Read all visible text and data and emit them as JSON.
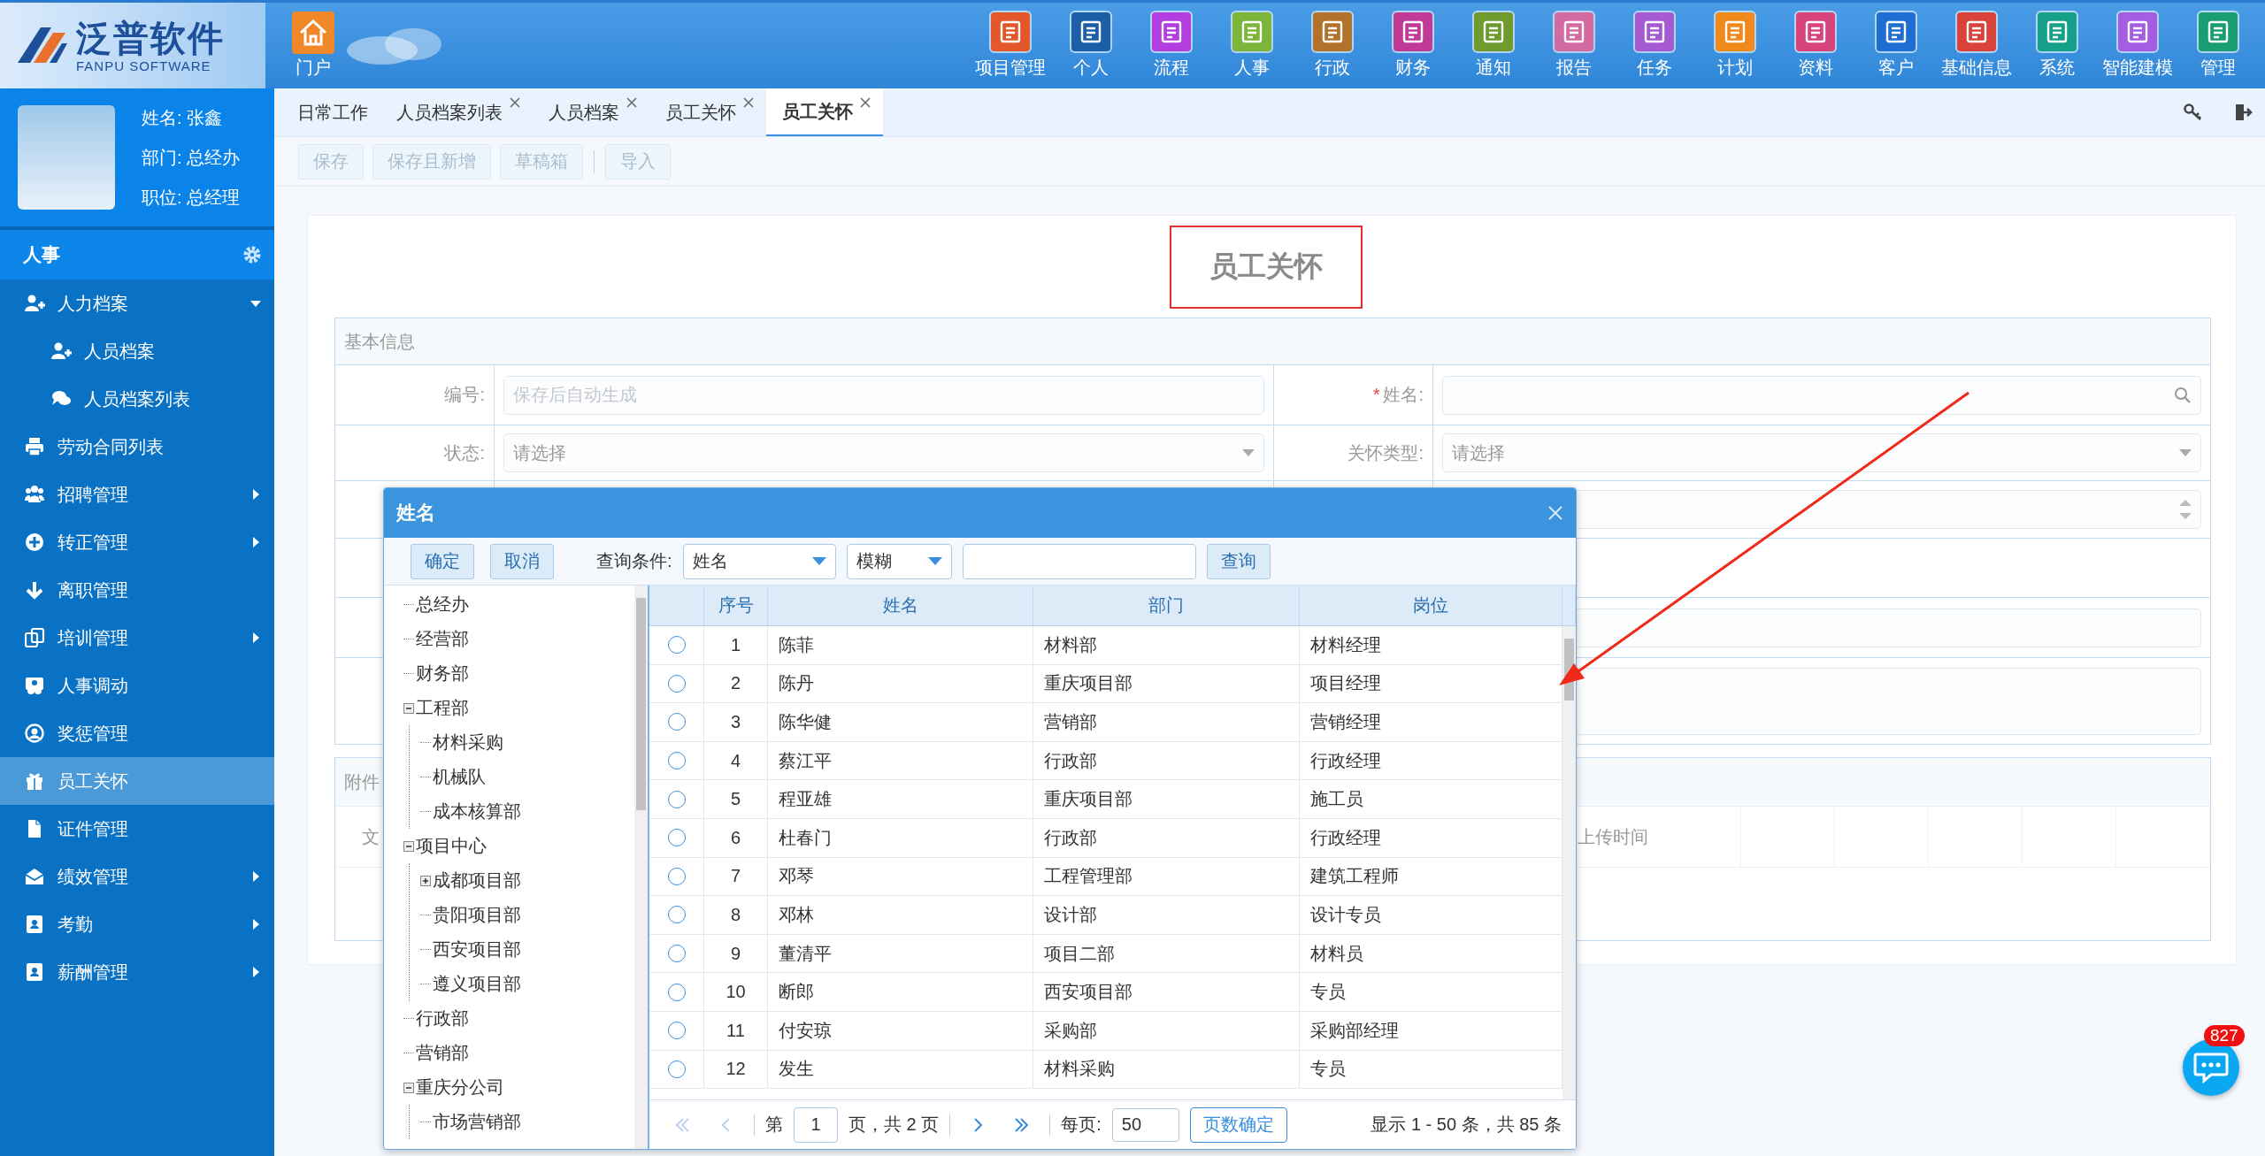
{
  "header": {
    "logo_title": "泛普软件",
    "logo_subtitle": "FANPU SOFTWARE",
    "portal": {
      "label": "门户"
    },
    "nav": [
      {
        "label": "项目管理",
        "color": "#e2582a"
      },
      {
        "label": "个人",
        "color": "#1d5fa6"
      },
      {
        "label": "流程",
        "color": "#b23de0"
      },
      {
        "label": "人事",
        "color": "#7cb53a"
      },
      {
        "label": "行政",
        "color": "#b3722c"
      },
      {
        "label": "财务",
        "color": "#c23a98"
      },
      {
        "label": "通知",
        "color": "#6e9a2e"
      },
      {
        "label": "报告",
        "color": "#d46aa2"
      },
      {
        "label": "任务",
        "color": "#a65ad2"
      },
      {
        "label": "计划",
        "color": "#f08a1c"
      },
      {
        "label": "资料",
        "color": "#d9437c"
      },
      {
        "label": "客户",
        "color": "#1f6fd2"
      },
      {
        "label": "基础信息",
        "color": "#d9433a"
      },
      {
        "label": "系统",
        "color": "#16a08a"
      },
      {
        "label": "智能建模",
        "color": "#a45ce2"
      },
      {
        "label": "管理",
        "color": "#189e72"
      }
    ]
  },
  "profile": {
    "name": "姓名: 张鑫",
    "department": "部门: 总经办",
    "position": "职位: 总经理"
  },
  "menu": {
    "title": "人事",
    "items": [
      {
        "label": "人力档案",
        "kind": "group",
        "expanded": true,
        "selected": false,
        "children": [
          {
            "label": "人员档案",
            "selected": false
          },
          {
            "label": "人员档案列表",
            "selected": false
          }
        ]
      },
      {
        "label": "劳动合同列表",
        "kind": "link",
        "selected": false
      },
      {
        "label": "招聘管理",
        "kind": "group",
        "expanded": false,
        "selected": false
      },
      {
        "label": "转正管理",
        "kind": "group",
        "expanded": false,
        "selected": false
      },
      {
        "label": "离职管理",
        "kind": "link",
        "selected": false
      },
      {
        "label": "培训管理",
        "kind": "group",
        "expanded": false,
        "selected": false
      },
      {
        "label": "人事调动",
        "kind": "link",
        "selected": false
      },
      {
        "label": "奖惩管理",
        "kind": "link",
        "selected": false
      },
      {
        "label": "员工关怀",
        "kind": "link",
        "selected": true
      },
      {
        "label": "证件管理",
        "kind": "link",
        "selected": false
      },
      {
        "label": "绩效管理",
        "kind": "group",
        "expanded": false,
        "selected": false
      },
      {
        "label": "考勤",
        "kind": "group",
        "expanded": false,
        "selected": false
      },
      {
        "label": "薪酬管理",
        "kind": "group",
        "expanded": false,
        "selected": false
      }
    ]
  },
  "tabs": [
    {
      "label": "日常工作",
      "closable": false,
      "selected": false
    },
    {
      "label": "人员档案列表",
      "closable": true,
      "selected": false
    },
    {
      "label": "人员档案",
      "closable": true,
      "selected": false
    },
    {
      "label": "员工关怀",
      "closable": true,
      "selected": false
    },
    {
      "label": "员工关怀",
      "closable": true,
      "selected": true
    }
  ],
  "toolbar": {
    "buttons": [
      {
        "label": "保存",
        "disabled": true
      },
      {
        "label": "保存且新增",
        "disabled": true
      },
      {
        "label": "草稿箱",
        "disabled": true
      },
      {
        "label": "导入",
        "disabled": true
      }
    ]
  },
  "form": {
    "title": "员工关怀",
    "section": "基本信息",
    "rows": [
      {
        "kind": "pair",
        "fields": [
          {
            "label": "编号:",
            "kind": "text",
            "placeholder": "保存后自动生成"
          },
          {
            "label": "姓名:",
            "kind": "lookup",
            "mark": "*"
          }
        ]
      },
      {
        "kind": "pair",
        "fields": [
          {
            "label": "状态:",
            "kind": "select",
            "placeholder": "请选择"
          },
          {
            "label": "关怀类型:",
            "kind": "select",
            "placeholder": "请选择"
          }
        ]
      },
      {
        "kind": "number"
      },
      {
        "kind": "blank"
      },
      {
        "kind": "wide"
      },
      {
        "kind": "textarea"
      }
    ]
  },
  "attachments": {
    "title": "附件",
    "columns": [
      "文",
      "上传时间"
    ]
  },
  "dialog": {
    "title": "姓名",
    "buttons": [
      "确定",
      "取消"
    ],
    "query_label": "查询条件:",
    "field_select": "姓名",
    "match_select": "模糊",
    "search_button": "查询",
    "tree": [
      {
        "label": "总经办",
        "kind": "leaf"
      },
      {
        "label": "经营部",
        "kind": "leaf"
      },
      {
        "label": "财务部",
        "kind": "leaf"
      },
      {
        "label": "工程部",
        "kind": "folder",
        "expanded": true,
        "children": [
          {
            "label": "材料采购",
            "kind": "leaf"
          },
          {
            "label": "机械队",
            "kind": "leaf"
          },
          {
            "label": "成本核算部",
            "kind": "leaf"
          }
        ]
      },
      {
        "label": "项目中心",
        "kind": "folder",
        "expanded": true,
        "children": [
          {
            "label": "成都项目部",
            "kind": "folder",
            "expanded": false
          },
          {
            "label": "贵阳项目部",
            "kind": "leaf"
          },
          {
            "label": "西安项目部",
            "kind": "leaf"
          },
          {
            "label": "遵义项目部",
            "kind": "leaf"
          }
        ]
      },
      {
        "label": "行政部",
        "kind": "leaf"
      },
      {
        "label": "营销部",
        "kind": "leaf"
      },
      {
        "label": "重庆分公司",
        "kind": "folder",
        "expanded": true,
        "children": [
          {
            "label": "市场营销部",
            "kind": "leaf"
          }
        ]
      }
    ],
    "columns": [
      "序号",
      "姓名",
      "部门",
      "岗位"
    ],
    "rows": [
      {
        "cells": [
          "1",
          "陈菲",
          "材料部",
          "材料经理"
        ],
        "selected": false
      },
      {
        "cells": [
          "2",
          "陈丹",
          "重庆项目部",
          "项目经理"
        ],
        "selected": false
      },
      {
        "cells": [
          "3",
          "陈华健",
          "营销部",
          "营销经理"
        ],
        "selected": false
      },
      {
        "cells": [
          "4",
          "蔡江平",
          "行政部",
          "行政经理"
        ],
        "selected": false
      },
      {
        "cells": [
          "5",
          "程亚雄",
          "重庆项目部",
          "施工员"
        ],
        "selected": false
      },
      {
        "cells": [
          "6",
          "杜春门",
          "行政部",
          "行政经理"
        ],
        "selected": false
      },
      {
        "cells": [
          "7",
          "邓琴",
          "工程管理部",
          "建筑工程师"
        ],
        "selected": false
      },
      {
        "cells": [
          "8",
          "邓林",
          "设计部",
          "设计专员"
        ],
        "selected": false
      },
      {
        "cells": [
          "9",
          "董清平",
          "项目二部",
          "材料员"
        ],
        "selected": false
      },
      {
        "cells": [
          "10",
          "断郎",
          "西安项目部",
          "专员"
        ],
        "selected": false
      },
      {
        "cells": [
          "11",
          "付安琼",
          "采购部",
          "采购部经理"
        ],
        "selected": false
      },
      {
        "cells": [
          "12",
          "发生",
          "材料采购",
          "专员"
        ],
        "selected": false
      }
    ],
    "pager": {
      "can_go_back": false,
      "can_go_forward": true,
      "page_prefix": "第",
      "page": "1",
      "page_suffix": "页，共 2 页",
      "per_page_label": "每页:",
      "per_page": "50",
      "apply_button": "页数确定",
      "summary": "显示 1 - 50 条，共 85 条"
    }
  },
  "chat": {
    "badge": "827"
  }
}
